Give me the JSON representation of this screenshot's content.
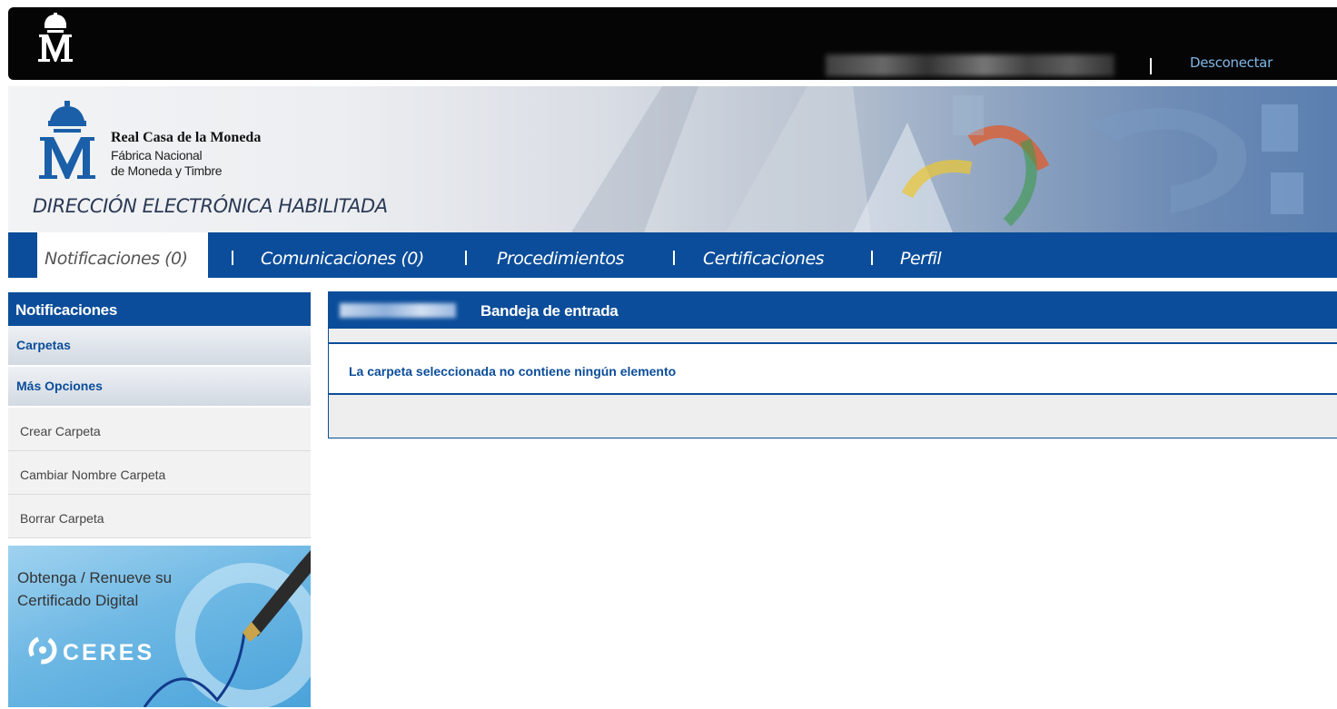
{
  "topbar": {
    "logo_icon": "crowned-m-logo",
    "user_name_redacted": true,
    "logout_label": "Desconectar"
  },
  "banner": {
    "org_name": "Real Casa de la Moneda",
    "org_sub1": "Fábrica Nacional",
    "org_sub2": "de Moneda y Timbre",
    "app_title": "DIRECCIÓN ELECTRÓNICA HABILITADA"
  },
  "nav": {
    "tabs": [
      {
        "label": "Notificaciones (0)",
        "active": true
      },
      {
        "label": "Comunicaciones (0)",
        "active": false
      },
      {
        "label": "Procedimientos",
        "active": false
      },
      {
        "label": "Certificaciones",
        "active": false
      },
      {
        "label": "Perfil",
        "active": false
      }
    ]
  },
  "sidebar": {
    "header": "Notificaciones",
    "groups": [
      "Carpetas",
      "Más Opciones"
    ],
    "options": [
      "Crear Carpeta",
      "Cambiar Nombre Carpeta",
      "Borrar Carpeta"
    ],
    "promo": {
      "line1": "Obtenga / Renueve su",
      "line2": "Certificado Digital",
      "brand": "CERES"
    }
  },
  "content": {
    "title": "Bandeja de entrada",
    "empty_message": "La carpeta seleccionada no contiene ningún elemento"
  },
  "colors": {
    "primary": "#0b4d9a",
    "link": "#7fb7e6",
    "topbar": "#050505"
  }
}
